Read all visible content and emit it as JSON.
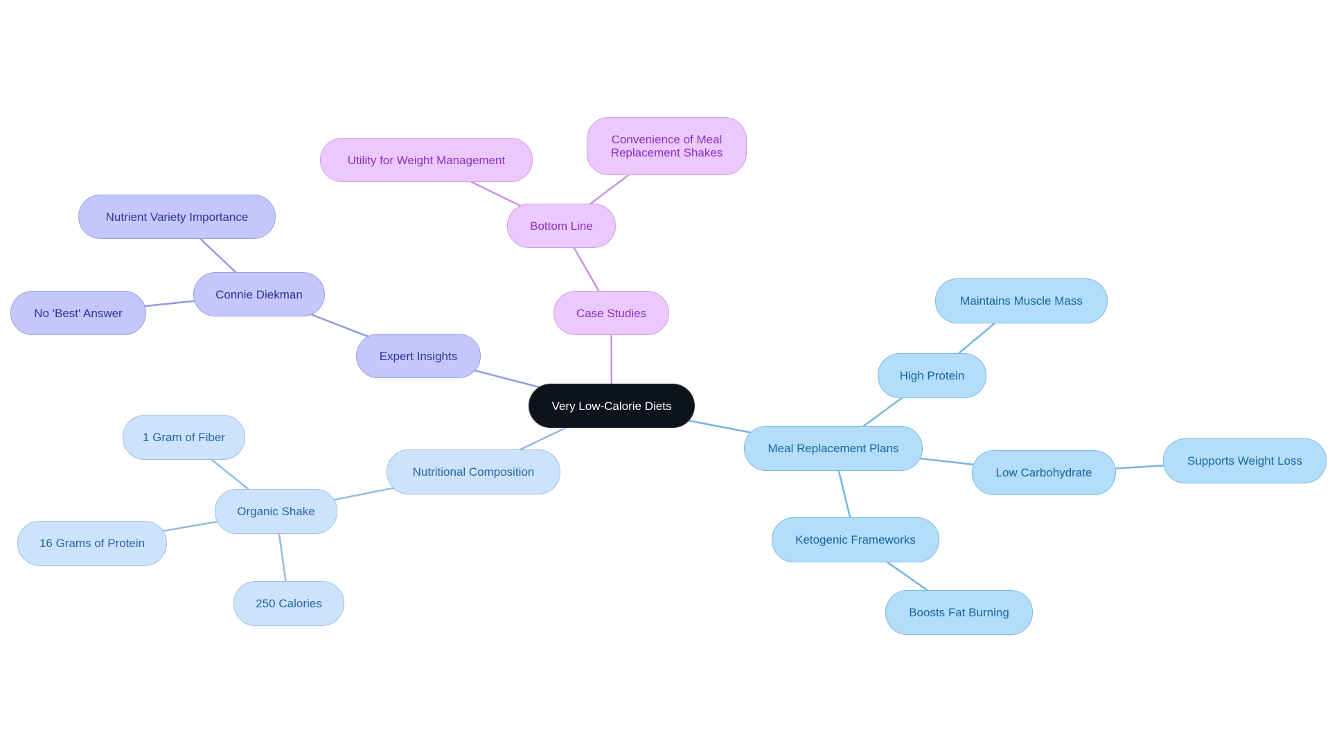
{
  "diagram": {
    "type": "mindmap",
    "root": "Very Low-Calorie Diets",
    "nodes": [
      {
        "id": "root",
        "label": "Very Low-Calorie Diets",
        "parent": null,
        "branch": "root"
      },
      {
        "id": "case-studies",
        "label": "Case Studies",
        "parent": "root",
        "branch": "purple"
      },
      {
        "id": "bottom-line",
        "label": "Bottom Line",
        "parent": "case-studies",
        "branch": "purple"
      },
      {
        "id": "utility",
        "label": "Utility for Weight Management",
        "parent": "bottom-line",
        "branch": "purple"
      },
      {
        "id": "convenience",
        "label": "Convenience of Meal Replacement Shakes",
        "parent": "bottom-line",
        "branch": "purple"
      },
      {
        "id": "expert-insights",
        "label": "Expert Insights",
        "parent": "root",
        "branch": "indigo"
      },
      {
        "id": "connie-diekman",
        "label": "Connie Diekman",
        "parent": "expert-insights",
        "branch": "indigo"
      },
      {
        "id": "nutrient-variety",
        "label": "Nutrient Variety Importance",
        "parent": "connie-diekman",
        "branch": "indigo"
      },
      {
        "id": "no-best-answer",
        "label": "No 'Best' Answer",
        "parent": "connie-diekman",
        "branch": "indigo"
      },
      {
        "id": "nutritional-composition",
        "label": "Nutritional Composition",
        "parent": "root",
        "branch": "lightblue"
      },
      {
        "id": "organic-shake",
        "label": "Organic Shake",
        "parent": "nutritional-composition",
        "branch": "lightblue"
      },
      {
        "id": "fiber",
        "label": "1 Gram of Fiber",
        "parent": "organic-shake",
        "branch": "lightblue"
      },
      {
        "id": "protein-16g",
        "label": "16 Grams of Protein",
        "parent": "organic-shake",
        "branch": "lightblue"
      },
      {
        "id": "calories-250",
        "label": "250 Calories",
        "parent": "organic-shake",
        "branch": "lightblue"
      },
      {
        "id": "meal-replacement",
        "label": "Meal Replacement Plans",
        "parent": "root",
        "branch": "skyblue"
      },
      {
        "id": "high-protein",
        "label": "High Protein",
        "parent": "meal-replacement",
        "branch": "skyblue"
      },
      {
        "id": "muscle-mass",
        "label": "Maintains Muscle Mass",
        "parent": "high-protein",
        "branch": "skyblue"
      },
      {
        "id": "low-carb",
        "label": "Low Carbohydrate",
        "parent": "meal-replacement",
        "branch": "skyblue"
      },
      {
        "id": "weight-loss",
        "label": "Supports Weight Loss",
        "parent": "low-carb",
        "branch": "skyblue"
      },
      {
        "id": "ketogenic",
        "label": "Ketogenic Frameworks",
        "parent": "meal-replacement",
        "branch": "skyblue"
      },
      {
        "id": "fat-burning",
        "label": "Boosts Fat Burning",
        "parent": "ketogenic",
        "branch": "skyblue"
      }
    ],
    "branch_colors": {
      "root": "#0d131b",
      "purple": "#ebc9fd",
      "indigo": "#c4c7fb",
      "lightblue": "#cde3fb",
      "skyblue": "#b3ddfb"
    },
    "edge_colors": {
      "purple": "#c792e6",
      "indigo": "#9498df",
      "lightblue": "#93b9e4",
      "skyblue": "#72b4e2"
    }
  }
}
